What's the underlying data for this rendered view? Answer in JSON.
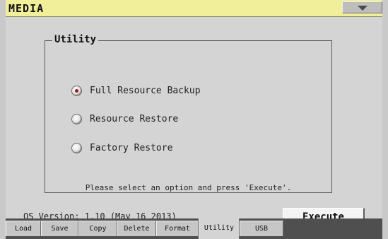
{
  "title_bar": {
    "title": "MEDIA",
    "menu_icon": "chevron-down-icon"
  },
  "utility": {
    "legend": "Utility",
    "options": [
      {
        "label": "Full Resource Backup",
        "selected": true
      },
      {
        "label": "Resource Restore",
        "selected": false
      },
      {
        "label": "Factory Restore",
        "selected": false
      }
    ],
    "hint": "Please select an option and press 'Execute'."
  },
  "footer": {
    "os_version": "OS Version: 1.10 (May 16 2013)",
    "execute_label": "Execute"
  },
  "tabs": [
    {
      "label": "Load",
      "active": false
    },
    {
      "label": "Save",
      "active": false
    },
    {
      "label": "Copy",
      "active": false
    },
    {
      "label": "Delete",
      "active": false
    },
    {
      "label": "Format",
      "active": false
    },
    {
      "label": "Utility",
      "active": true
    },
    {
      "label": "USB",
      "active": false
    }
  ],
  "colors": {
    "title_bar_bg": "#f2ef9a",
    "panel_bg": "#d4d4d4",
    "tab_strip_bg": "#4f4f4f",
    "selected_radio_dot": "#a01818"
  }
}
